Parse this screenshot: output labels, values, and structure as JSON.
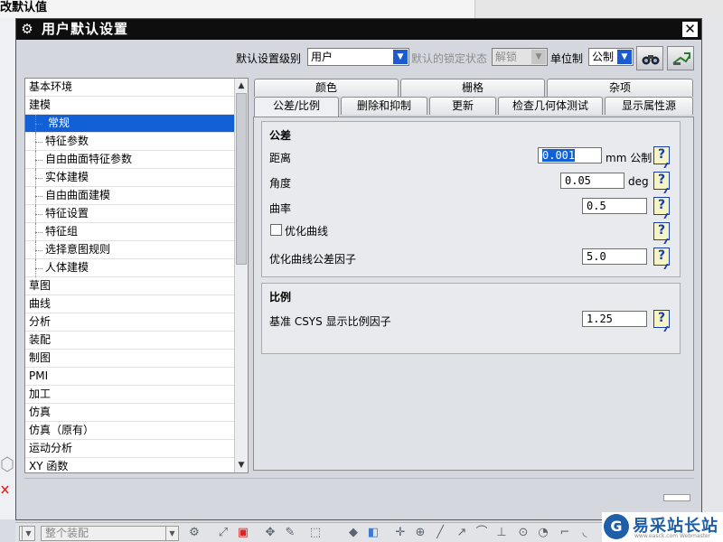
{
  "host": {
    "title": "改默认值"
  },
  "dialog": {
    "title": "用户默认设置",
    "close_label": "✕",
    "toolbar": {
      "level_label": "默认设置级别",
      "level_value": "用户",
      "lock_label": "默认的锁定状态",
      "lock_value": "解锁",
      "unit_label": "单位制",
      "unit_value": "公制"
    },
    "tree": {
      "items": [
        {
          "label": "基本环境",
          "child": false
        },
        {
          "label": "建模",
          "child": false
        },
        {
          "label": "常规",
          "child": true,
          "selected": true
        },
        {
          "label": "特征参数",
          "child": true
        },
        {
          "label": "自由曲面特征参数",
          "child": true
        },
        {
          "label": "实体建模",
          "child": true
        },
        {
          "label": "自由曲面建模",
          "child": true
        },
        {
          "label": "特征设置",
          "child": true
        },
        {
          "label": "特征组",
          "child": true
        },
        {
          "label": "选择意图规则",
          "child": true
        },
        {
          "label": "人体建模",
          "child": true
        },
        {
          "label": "草图",
          "child": false
        },
        {
          "label": "曲线",
          "child": false
        },
        {
          "label": "分析",
          "child": false
        },
        {
          "label": "装配",
          "child": false
        },
        {
          "label": "制图",
          "child": false
        },
        {
          "label": "PMI",
          "child": false
        },
        {
          "label": "加工",
          "child": false
        },
        {
          "label": "仿真",
          "child": false
        },
        {
          "label": "仿真（原有）",
          "child": false
        },
        {
          "label": "运动分析",
          "child": false
        },
        {
          "label": "XY 函数",
          "child": false
        }
      ]
    },
    "tabs_row1": [
      "颜色",
      "栅格",
      "杂项"
    ],
    "tabs_row2": [
      "公差/比例",
      "删除和抑制",
      "更新",
      "检查几何体测试",
      "显示属性源"
    ],
    "active_tab": "公差/比例",
    "tolerance": {
      "title": "公差",
      "distance_label": "距离",
      "distance_value": "0.001",
      "distance_unit": "mm 公制",
      "angle_label": "角度",
      "angle_value": "0.05",
      "angle_unit": "deg",
      "curvature_label": "曲率",
      "curvature_value": "0.5",
      "optimize_label": "优化曲线",
      "optimize_checked": false,
      "optimize_factor_label": "优化曲线公差因子",
      "optimize_factor_value": "5.0"
    },
    "scale": {
      "title": "比例",
      "csys_label": "基准 CSYS 显示比例因子",
      "csys_value": "1.25"
    },
    "help_glyph": "?"
  },
  "bottom_toolbar": {
    "assembly_combo": "整个装配"
  },
  "watermark": {
    "logo_glyph": "G",
    "text": "易采站长站",
    "sub": "www.easck.com Webmaster"
  },
  "colors": {
    "titlebar": "#0e0e0e",
    "selection": "#1260d6",
    "help_border": "#1b3fa8",
    "combo_arrow": "#1d5bd1"
  }
}
